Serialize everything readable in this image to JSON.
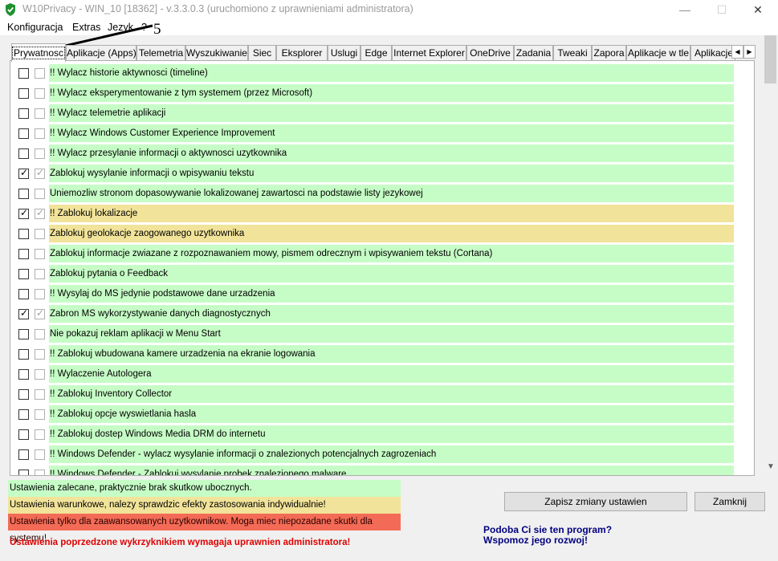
{
  "window": {
    "title": "W10Privacy - WIN_10 [18362]  - v.3.3.0.3 (uruchomiono z uprawnieniami administratora)",
    "controls": {
      "minimize": "—",
      "maximize": "☐",
      "close": "✕"
    }
  },
  "menu": [
    "Konfiguracja",
    "Extras",
    "Jezyk",
    "?"
  ],
  "annotation": {
    "label": "5"
  },
  "tabs": [
    "Prywatnosc",
    "Aplikacje (Apps)",
    "Telemetria",
    "Wyszukiwanie",
    "Siec",
    "Eksplorer",
    "Uslugi",
    "Edge",
    "Internet Explorer",
    "OneDrive",
    "Zadania",
    "Tweaki",
    "Zapora",
    "Aplikacje w tle",
    "Aplikacje"
  ],
  "active_tab": "Prywatnosc",
  "tab_scroll": {
    "left": "◀",
    "right": "▶"
  },
  "settings": [
    {
      "label": "!! Wylacz historie aktywnosci (timeline)",
      "checked": false,
      "level": "green"
    },
    {
      "label": "!! Wylacz eksperymentowanie z tym systemem (przez Microsoft)",
      "checked": false,
      "level": "green"
    },
    {
      "label": "!! Wylacz telemetrie aplikacji",
      "checked": false,
      "level": "green"
    },
    {
      "label": "!! Wylacz Windows Customer Experience Improvement",
      "checked": false,
      "level": "green"
    },
    {
      "label": "!! Wylacz przesylanie informacji o aktywnosci uzytkownika",
      "checked": false,
      "level": "green"
    },
    {
      "label": "Zablokuj wysylanie informacji o wpisywaniu tekstu",
      "checked": true,
      "level": "green"
    },
    {
      "label": "Uniemozliw stronom dopasowywanie lokalizowanej zawartosci na podstawie listy jezykowej",
      "checked": false,
      "level": "green"
    },
    {
      "label": "!! Zablokuj lokalizacje",
      "checked": true,
      "level": "yellow"
    },
    {
      "label": "Zablokuj geolokacje zaogowanego uzytkownika",
      "checked": false,
      "level": "yellow"
    },
    {
      "label": "Zablokuj informacje zwiazane z rozpoznawaniem mowy, pismem odrecznym i wpisywaniem tekstu (Cortana)",
      "checked": false,
      "level": "green"
    },
    {
      "label": "Zablokuj pytania o Feedback",
      "checked": false,
      "level": "green"
    },
    {
      "label": "!! Wysylaj do MS jedynie podstawowe dane urzadzenia",
      "checked": false,
      "level": "green"
    },
    {
      "label": "Zabron MS wykorzystywanie danych diagnostycznych",
      "checked": true,
      "level": "green"
    },
    {
      "label": "Nie pokazuj reklam aplikacji w Menu Start",
      "checked": false,
      "level": "green"
    },
    {
      "label": "!! Zablokuj wbudowana kamere urzadzenia na ekranie logowania",
      "checked": false,
      "level": "green"
    },
    {
      "label": "!! Wylaczenie Autologera",
      "checked": false,
      "level": "green"
    },
    {
      "label": "!! Zablokuj Inventory Collector",
      "checked": false,
      "level": "green"
    },
    {
      "label": "!! Zablokuj opcje wyswietlania hasla",
      "checked": false,
      "level": "green"
    },
    {
      "label": "!! Zablokuj dostep Windows Media DRM do internetu",
      "checked": false,
      "level": "green"
    },
    {
      "label": "!! Windows Defender - wylacz wysylanie informacji o znalezionych potencjalnych zagrozeniach",
      "checked": false,
      "level": "green"
    },
    {
      "label": "!! Windows Defender - Zablokuj wysylanie probek znalezionego malware",
      "checked": false,
      "level": "green"
    }
  ],
  "check_glyph": "✓",
  "scroll_arrow": "▼",
  "legend": {
    "green": "Ustawienia zalecane, praktycznie brak skutkow ubocznych.",
    "yellow": "Ustawienia warunkowe, nalezy sprawdzic efekty zastosowania indywidualnie!",
    "red": "Ustawienia tylko dla zaawansowanych uzytkownikow. Moga miec niepozadane skutki dla systemu!"
  },
  "admin_note": "Ustawienia poprzedzone wykrzyknikiem wymagaja uprawnien administratora!",
  "buttons": {
    "save": "Zapisz zmiany ustawien",
    "close": "Zamknij"
  },
  "promo": {
    "line1": "Podoba Ci sie ten program?",
    "line2": "Wspomoz jego rozwoj!"
  },
  "colors": {
    "green": "#c6fdc6",
    "yellow": "#f1e399",
    "red": "#f36b56",
    "admin_note": "#e00000",
    "promo": "#000080"
  }
}
